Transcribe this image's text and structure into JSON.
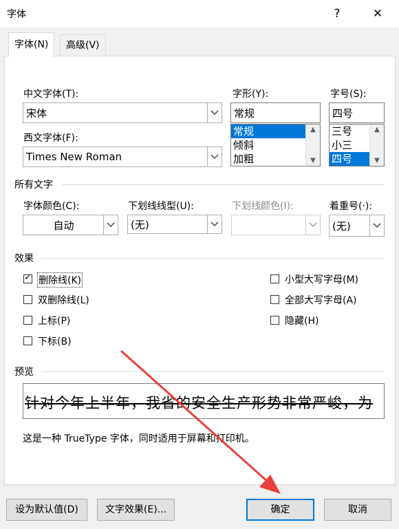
{
  "window": {
    "title": "字体",
    "help": "?",
    "close": "✕"
  },
  "tabs": [
    {
      "label": "字体(N)",
      "active": true
    },
    {
      "label": "高级(V)",
      "active": false
    }
  ],
  "chinese_font": {
    "label": "中文字体(T):",
    "value": "宋体"
  },
  "western_font": {
    "label": "西文字体(F):",
    "value": "Times New Roman"
  },
  "style": {
    "label": "字形(Y):",
    "value": "常规",
    "options": [
      "常规",
      "倾斜",
      "加粗"
    ],
    "selected": "常规"
  },
  "size": {
    "label": "字号(S):",
    "value": "四号",
    "options": [
      "三号",
      "小三",
      "四号"
    ],
    "selected": "四号"
  },
  "all_text": {
    "section": "所有文字",
    "font_color": {
      "label": "字体颜色(C):",
      "value": "自动"
    },
    "underline_style": {
      "label": "下划线线型(U):",
      "value": "(无)"
    },
    "underline_color": {
      "label": "下划线颜色(I):",
      "value": ""
    },
    "emphasis": {
      "label": "着重号(·):",
      "value": "(无)"
    }
  },
  "effects": {
    "section": "效果",
    "strikethrough": {
      "label": "删除线(K)",
      "checked": true
    },
    "double_strikethrough": {
      "label": "双删除线(L)",
      "checked": false
    },
    "superscript": {
      "label": "上标(P)",
      "checked": false
    },
    "subscript": {
      "label": "下标(B)",
      "checked": false
    },
    "small_caps": {
      "label": "小型大写字母(M)",
      "checked": false
    },
    "all_caps": {
      "label": "全部大写字母(A)",
      "checked": false
    },
    "hidden": {
      "label": "隐藏(H)",
      "checked": false
    }
  },
  "preview": {
    "section": "预览",
    "text": "针对今年上半年，我省的安全生产形势非常严峻，为",
    "note": "这是一种 TrueType 字体，同时适用于屏幕和打印机。"
  },
  "buttons": {
    "set_default": "设为默认值(D)",
    "text_effects": "文字效果(E)...",
    "ok": "确定",
    "cancel": "取消"
  },
  "colors": {
    "selection": "#0078d7",
    "annotation_arrow": "#e8413c"
  }
}
